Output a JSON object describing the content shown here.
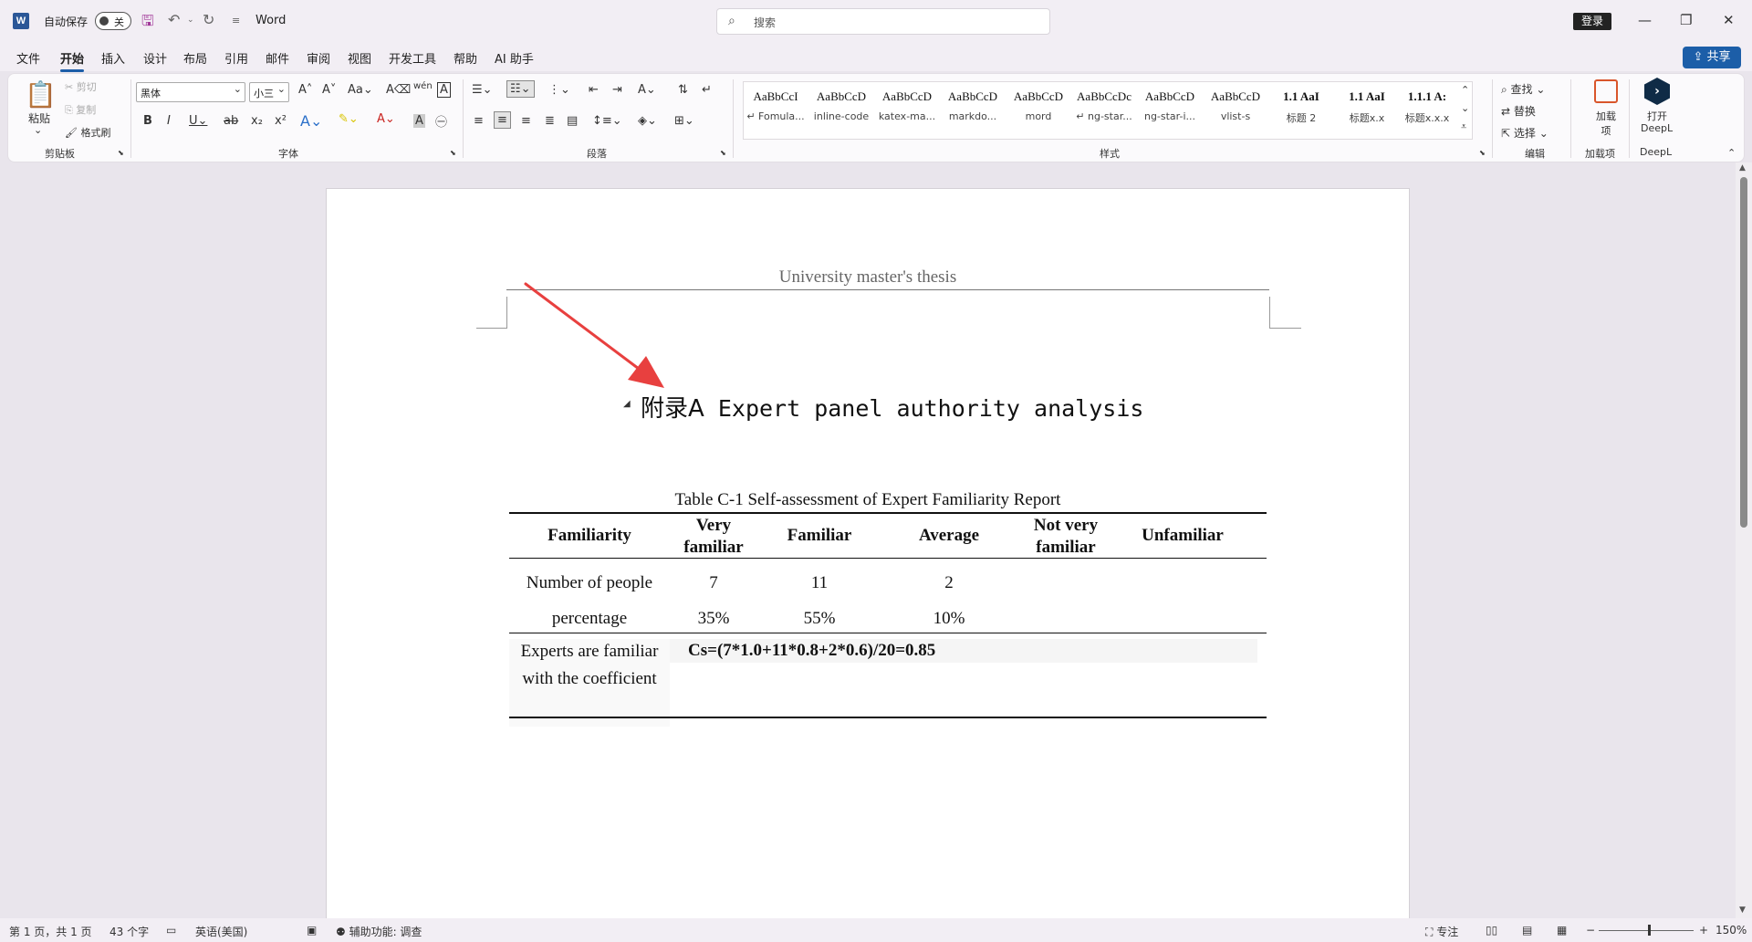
{
  "titlebar": {
    "autosave_label": "自动保存",
    "autosave_state": "关",
    "app_name": "Word",
    "search_placeholder": "搜索",
    "login_label": "登录"
  },
  "menu": {
    "items": [
      "文件",
      "开始",
      "插入",
      "设计",
      "布局",
      "引用",
      "邮件",
      "审阅",
      "视图",
      "开发工具",
      "帮助",
      "AI 助手"
    ],
    "active": "开始",
    "share_label": "共享"
  },
  "ribbon": {
    "clipboard": {
      "paste": "粘贴",
      "cut": "剪切",
      "copy": "复制",
      "format_painter": "格式刷",
      "label": "剪贴板"
    },
    "font": {
      "name": "黑体",
      "size": "小三",
      "label": "字体"
    },
    "paragraph": {
      "label": "段落"
    },
    "styles": {
      "label": "样式",
      "items": [
        {
          "preview": "AaBbCcI",
          "name": "↵ Fomula..."
        },
        {
          "preview": "AaBbCcD",
          "name": "inline-code"
        },
        {
          "preview": "AaBbCcD",
          "name": "katex-ma..."
        },
        {
          "preview": "AaBbCcD",
          "name": "markdo..."
        },
        {
          "preview": "AaBbCcD",
          "name": "mord"
        },
        {
          "preview": "AaBbCcDc",
          "name": "↵ ng-star..."
        },
        {
          "preview": "AaBbCcD",
          "name": "ng-star-i..."
        },
        {
          "preview": "AaBbCcD",
          "name": "vlist-s"
        },
        {
          "preview": "1.1  AaI",
          "name": "标题 2"
        },
        {
          "preview": "1.1  AaI",
          "name": "标题x.x"
        },
        {
          "preview": "1.1.1  A:",
          "name": "标题x.x.x"
        }
      ]
    },
    "editing": {
      "find": "查找",
      "replace": "替换",
      "select": "选择",
      "label": "编辑"
    },
    "addins": {
      "button": "加载项",
      "label": "加载项"
    },
    "deepl": {
      "button_line1": "打开",
      "button_line2": "DeepL",
      "label": "DeepL"
    }
  },
  "document": {
    "header": "University master's thesis",
    "heading_cjk": "附录A",
    "heading_en": " Expert panel authority analysis",
    "caption": "Table C-1 Self-assessment of Expert Familiarity Report",
    "table": {
      "headers": [
        "Familiarity",
        "Very familiar",
        "Familiar",
        "Average",
        "Not very familiar",
        "Unfamiliar"
      ],
      "row_people": {
        "label": "Number of people",
        "values": [
          "7",
          "11",
          "2",
          "",
          ""
        ]
      },
      "row_percent": {
        "label": "percentage",
        "values": [
          "35%",
          "55%",
          "10%",
          "",
          ""
        ]
      },
      "row_coef": {
        "label": "Experts are familiar with the coefficient",
        "formula": "Cs=(7*1.0+11*0.8+2*0.6)/20=0.85"
      }
    }
  },
  "statusbar": {
    "page": "第 1 页，共 1 页",
    "words": "43 个字",
    "language": "英语(美国)",
    "accessibility": "辅助功能: 调查",
    "focus": "专注",
    "zoom": "150%"
  }
}
